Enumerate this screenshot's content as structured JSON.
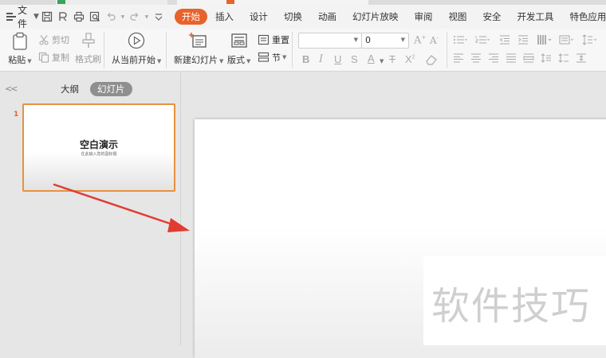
{
  "menubar": {
    "file_label": "文件",
    "items": [
      "开始",
      "插入",
      "设计",
      "切换",
      "动画",
      "幻灯片放映",
      "审阅",
      "视图",
      "安全",
      "开发工具",
      "特色应用"
    ],
    "active_index": 0
  },
  "ribbon": {
    "paste": "粘贴",
    "cut": "剪切",
    "copy": "复制",
    "format_painter": "格式刷",
    "play_from_current": "从当前开始",
    "new_slide": "新建幻灯片",
    "layout": "版式",
    "reset": "重置",
    "section": "节",
    "font_size_value": "0"
  },
  "panel": {
    "tab_outline": "大纲",
    "tab_slides": "幻灯片",
    "slide_number": "1",
    "thumb_title": "空白演示",
    "thumb_subtitle": "在此输入您的副标题"
  },
  "watermark": "软件技巧",
  "colors": {
    "accent": "#e8622c",
    "thumb_border": "#e8913f",
    "arrow": "#e03c32"
  }
}
